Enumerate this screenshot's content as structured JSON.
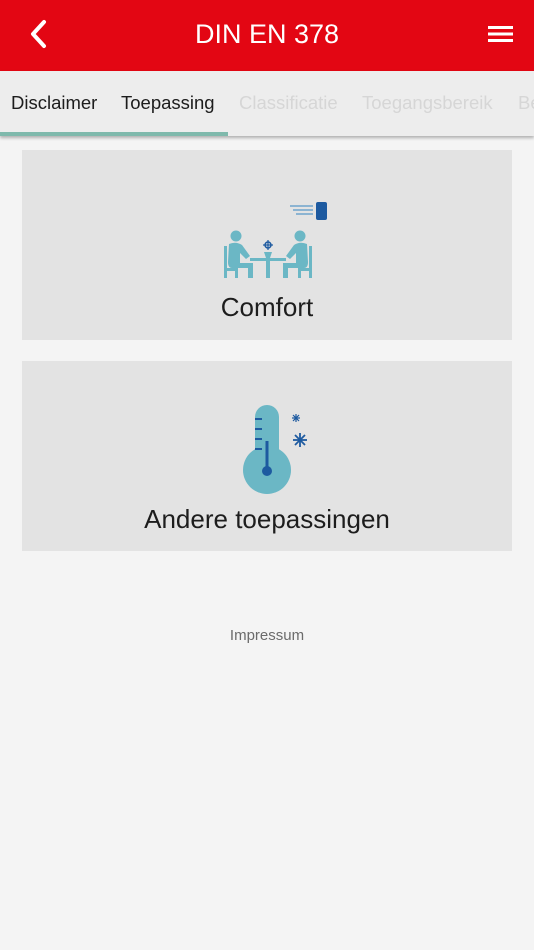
{
  "header": {
    "title": "DIN EN 378",
    "back_icon": "chevron-left-icon",
    "menu_icon": "hamburger-menu-icon",
    "background_color": "#e30613"
  },
  "tabs": [
    {
      "label": "Disclaimer"
    },
    {
      "label": "Toepassing"
    },
    {
      "label": "Classificatie"
    },
    {
      "label": "Toegangsbereik"
    },
    {
      "label": "Be"
    }
  ],
  "active_tab": "Toepassing",
  "accent_color": "#7fb9ac",
  "cards": [
    {
      "label": "Comfort",
      "icon": "people-at-table-with-air-conditioner-icon"
    },
    {
      "label": "Andere toepassingen",
      "icon": "thermometer-with-snowflakes-icon"
    }
  ],
  "footer": {
    "impressum_label": "Impressum"
  }
}
